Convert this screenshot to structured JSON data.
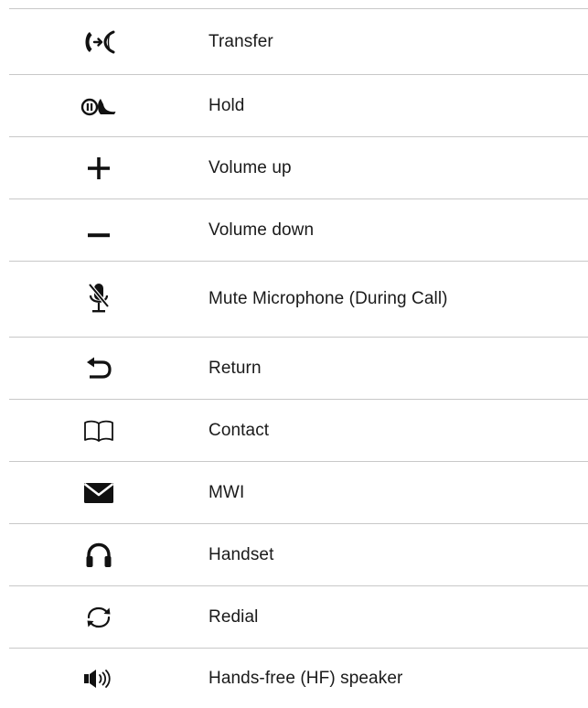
{
  "rows": [
    {
      "icon": "transfer-icon",
      "label": "Transfer"
    },
    {
      "icon": "hold-icon",
      "label": "Hold"
    },
    {
      "icon": "plus-icon",
      "label": "Volume up"
    },
    {
      "icon": "minus-icon",
      "label": "Volume down"
    },
    {
      "icon": "mute-microphone-icon",
      "label": "Mute Microphone (During Call)"
    },
    {
      "icon": "return-icon",
      "label": "Return"
    },
    {
      "icon": "book-icon",
      "label": "Contact"
    },
    {
      "icon": "envelope-icon",
      "label": "MWI"
    },
    {
      "icon": "headphones-icon",
      "label": "Handset"
    },
    {
      "icon": "redial-icon",
      "label": "Redial"
    },
    {
      "icon": "speaker-icon",
      "label": "Hands-free (HF) speaker"
    }
  ],
  "colors": {
    "text": "#1a1a1a",
    "divider": "#c8c8c8"
  }
}
